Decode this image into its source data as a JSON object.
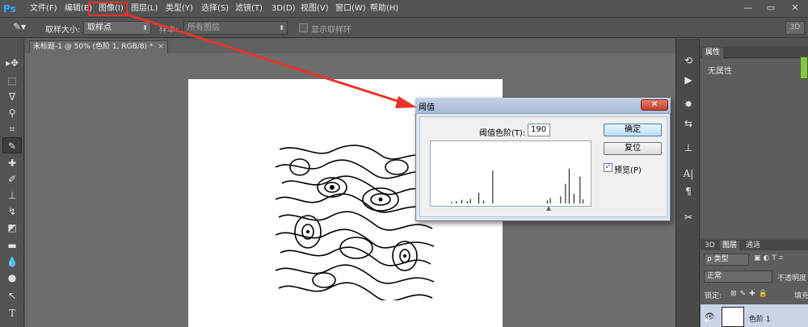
{
  "app": {
    "logo": "Ps"
  },
  "menu": [
    "文件(F)",
    "编辑(E)",
    "图像(I)",
    "图层(L)",
    "类型(Y)",
    "选择(S)",
    "滤镜(T)",
    "3D(D)",
    "视图(V)",
    "窗口(W)",
    "帮助(H)"
  ],
  "window_controls": {
    "minimize": "—",
    "restore": "▭",
    "close": "✕"
  },
  "options": {
    "sample_size_label": "取样大小:",
    "sample_size_value": "取样点",
    "sample_label": "样本:",
    "sample_value": "所有图层",
    "show_ring_label": "显示取样环",
    "three_d": "3D"
  },
  "document": {
    "tab_title": "未标题-1 @ 50% (色阶 1, RGB/8) *",
    "close": "×"
  },
  "tools": [
    "move-tool",
    "marquee-tool",
    "lasso-tool",
    "quick-select-tool",
    "crop-tool",
    "eyedropper-tool",
    "healing-tool",
    "brush-tool",
    "stamp-tool",
    "history-brush-tool",
    "eraser-tool",
    "gradient-tool",
    "blur-tool",
    "dodge-tool",
    "path-select-tool",
    "type-tool"
  ],
  "type_tool_glyph": "T",
  "panel_strip_icons": [
    "history-icon",
    "play-icon",
    "brush-preset-icon",
    "adjust-icon",
    "stamp-icon",
    "character-icon",
    "paragraph-icon",
    "tools-icon"
  ],
  "properties": {
    "tab": "属性",
    "empty": "无属性"
  },
  "layers": {
    "tabs": [
      "3D",
      "图层",
      "通道"
    ],
    "filter_value": "ρ 类型",
    "blend_mode": "正常",
    "opacity_label": "不透明度",
    "lock_label": "锁定:",
    "fill_label": "填充",
    "layer_name": "色阶 1"
  },
  "dialog": {
    "title": "阈值",
    "close": "✕",
    "threshold_label": "阈值色阶(T):",
    "threshold_value": "190",
    "ok": "确定",
    "reset": "复位",
    "preview_label": "预览(P)",
    "preview_checked": "✓"
  },
  "histogram": {
    "bars": [
      {
        "level": 30,
        "height": 0.03
      },
      {
        "level": 38,
        "height": 0.04
      },
      {
        "level": 47,
        "height": 0.06
      },
      {
        "level": 56,
        "height": 0.04
      },
      {
        "level": 61,
        "height": 0.08
      },
      {
        "level": 75,
        "height": 0.18
      },
      {
        "level": 83,
        "height": 0.05
      },
      {
        "level": 98,
        "height": 0.55
      },
      {
        "level": 188,
        "height": 0.05
      },
      {
        "level": 193,
        "height": 0.09
      },
      {
        "level": 210,
        "height": 0.12
      },
      {
        "level": 218,
        "height": 0.33
      },
      {
        "level": 224,
        "height": 0.58
      },
      {
        "level": 232,
        "height": 0.16
      },
      {
        "level": 242,
        "height": 0.45
      },
      {
        "level": 247,
        "height": 0.07
      }
    ]
  }
}
